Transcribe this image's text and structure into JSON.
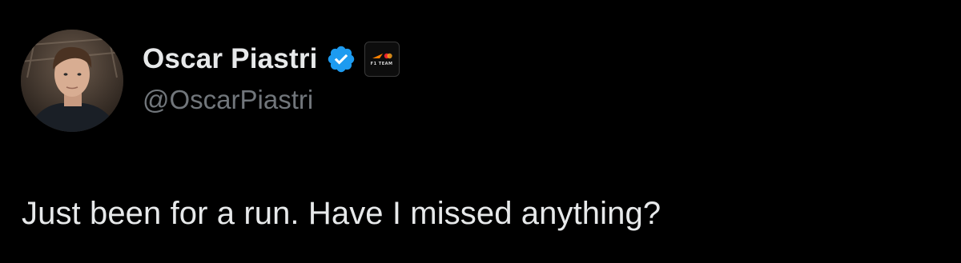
{
  "tweet": {
    "author": {
      "display_name": "Oscar Piastri",
      "handle": "@OscarPiastri",
      "avatar": "profile-photo",
      "verified_icon": "verified-badge-icon",
      "affiliate_badge": {
        "icon": "mclaren-f1-team-logo",
        "text": "F1 TEAM"
      }
    },
    "text": "Just been for a run. Have I missed anything?"
  },
  "colors": {
    "background": "#000000",
    "primary_text": "#e7e9ea",
    "secondary_text": "#71767b",
    "verified_blue": "#1d9bf0",
    "brand_orange": "#ff8000"
  }
}
